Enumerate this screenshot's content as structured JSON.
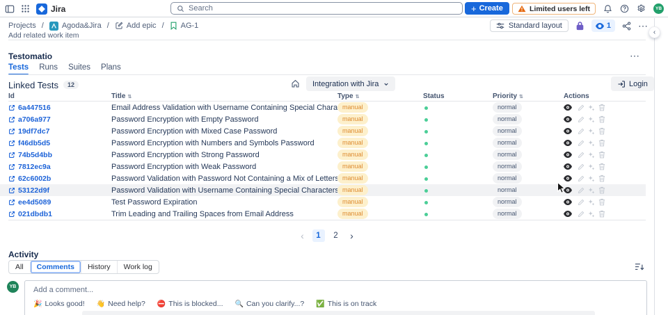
{
  "topbar": {
    "app_name": "Jira",
    "search_placeholder": "Search",
    "create_label": "Create",
    "warning_label": "Limited users left",
    "avatar_initials": "YB"
  },
  "breadcrumb": {
    "projects": "Projects",
    "project_name": "Agoda&Jira",
    "add_epic": "Add epic",
    "issue_key": "AG-1",
    "separator": "/"
  },
  "issue_toolbar": {
    "standard_layout_label": "Standard layout",
    "watch_count": "1"
  },
  "page": {
    "add_related_work_item": "Add related work item"
  },
  "testomatio": {
    "title": "Testomatio",
    "tabs": [
      "Tests",
      "Runs",
      "Suites",
      "Plans"
    ],
    "active_tab": "Tests",
    "linked_tests_label": "Linked Tests",
    "linked_tests_count": "12",
    "integration_dropdown_value": "Integration with Jira",
    "login_label": "Login",
    "table": {
      "headers": {
        "id": "Id",
        "title": "Title",
        "type": "Type",
        "status": "Status",
        "priority": "Priority",
        "actions": "Actions"
      },
      "rows": [
        {
          "id": "6a447516",
          "title": "Email Address Validation with Username Containing Special Characters",
          "type": "manual",
          "status": "passed",
          "priority": "normal"
        },
        {
          "id": "a706a977",
          "title": "Password Encryption with Empty Password",
          "type": "manual",
          "status": "passed",
          "priority": "normal"
        },
        {
          "id": "19df7dc7",
          "title": "Password Encryption with Mixed Case Password",
          "type": "manual",
          "status": "passed",
          "priority": "normal"
        },
        {
          "id": "f46db5d5",
          "title": "Password Encryption with Numbers and Symbols Password",
          "type": "manual",
          "status": "passed",
          "priority": "normal"
        },
        {
          "id": "74b5d4bb",
          "title": "Password Encryption with Strong Password",
          "type": "manual",
          "status": "passed",
          "priority": "normal"
        },
        {
          "id": "7812ec9a",
          "title": "Password Encryption with Weak Password",
          "type": "manual",
          "status": "passed",
          "priority": "normal"
        },
        {
          "id": "62c6002b",
          "title": "Password Validation with Password Not Containing a Mix of Letters and Numbers",
          "type": "manual",
          "status": "passed",
          "priority": "normal"
        },
        {
          "id": "53122d9f",
          "title": "Password Validation with Username Containing Special Characters",
          "type": "manual",
          "status": "passed",
          "priority": "normal",
          "highlight": true
        },
        {
          "id": "ee4d5089",
          "title": "Test Password Expiration",
          "type": "manual",
          "status": "passed",
          "priority": "normal"
        },
        {
          "id": "021dbdb1",
          "title": "Trim Leading and Trailing Spaces from Email Address",
          "type": "manual",
          "status": "passed",
          "priority": "normal"
        }
      ]
    },
    "pagination": {
      "pages": [
        "1",
        "2"
      ],
      "current": "1"
    }
  },
  "activity": {
    "title": "Activity",
    "filters": [
      "All",
      "Comments",
      "History",
      "Work log"
    ],
    "active_filter": "Comments",
    "avatar_initials": "YB",
    "comment_placeholder": "Add a comment...",
    "quick_replies": [
      {
        "emoji": "🎉",
        "label": "Looks good!"
      },
      {
        "emoji": "👋",
        "label": "Need help?"
      },
      {
        "emoji": "⛔",
        "label": "This is blocked..."
      },
      {
        "emoji": "🔍",
        "label": "Can you clarify...?"
      },
      {
        "emoji": "✅",
        "label": "This is on track"
      }
    ]
  },
  "glyphs": {
    "more": "⋯",
    "sort": "⇅",
    "chevron_left": "‹",
    "chevron_right": "›",
    "collapse": "‹",
    "plus": "+"
  },
  "colors": {
    "brand_blue": "#1868db",
    "link_blue": "#1d63d8",
    "warning_orange": "#e56910",
    "status_green": "#4bce97",
    "lock_purple": "#6e5dc6",
    "type_badge_bg": "#fdf0cc",
    "type_badge_text": "#dd8a2e",
    "priority_badge_bg": "#f1f2f4",
    "row_highlight": "#f1f2f4",
    "pagination_active_bg": "#e9f2ff"
  }
}
